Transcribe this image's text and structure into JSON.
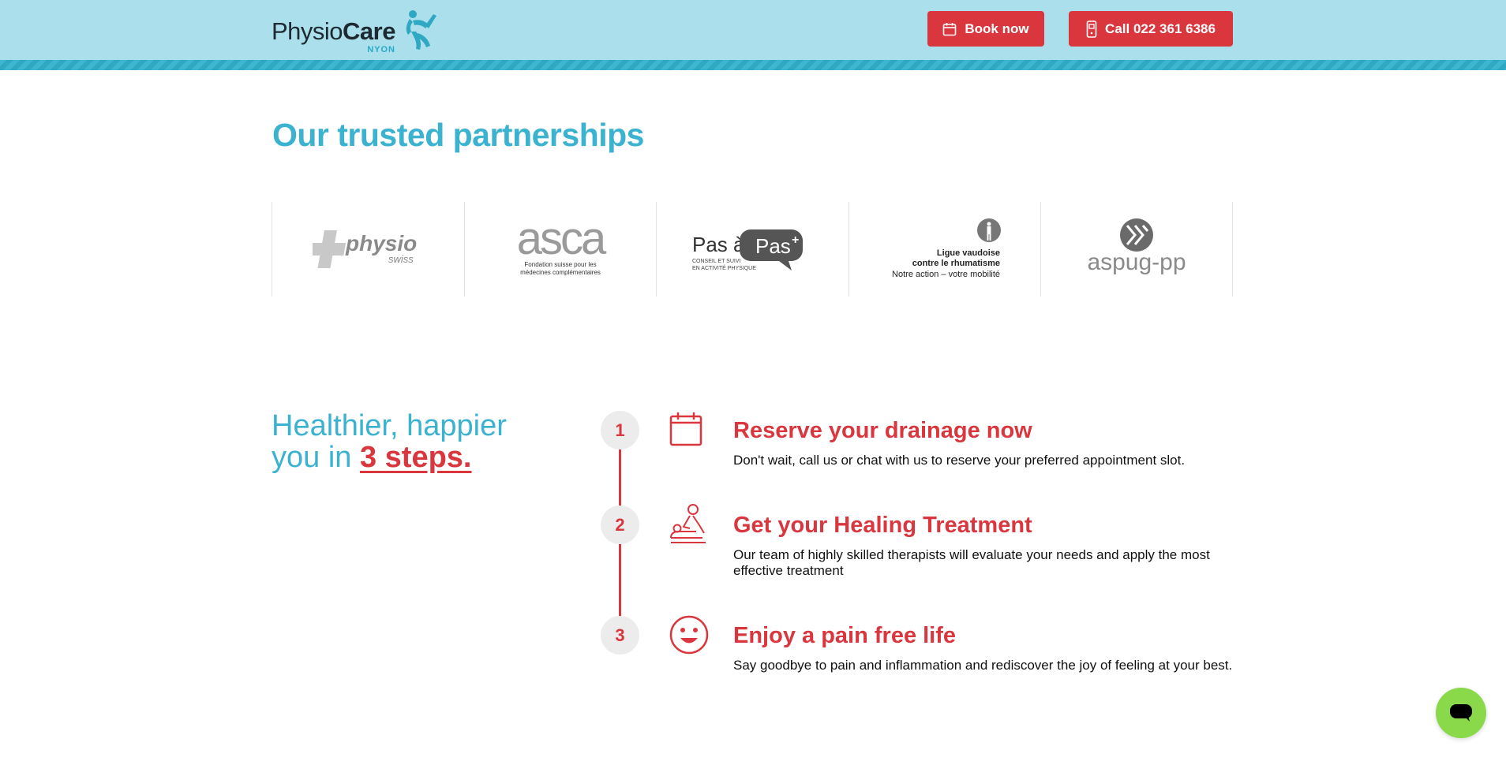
{
  "header": {
    "logo_light": "Physio",
    "logo_bold": "Care",
    "logo_sub": "NYON",
    "book_label": "Book now",
    "call_label": "Call 022 361 6386"
  },
  "partners": {
    "title": "Our trusted partnerships",
    "logos": [
      {
        "name": "physio",
        "sub": "swiss"
      },
      {
        "name": "asca",
        "sub1": "Fondation suisse pour les",
        "sub2": "médecines complémentaires"
      },
      {
        "name": "Pas à",
        "badge": "Pas",
        "plus": "+",
        "sub1": "CONSEIL ET SUIVI",
        "sub2": "EN ACTIVITÉ PHYSIQUE"
      },
      {
        "line1": "Ligue vaudoise",
        "line2": "contre le rhumatisme",
        "line3": "Notre action – votre mobilité"
      },
      {
        "name": "aspug-pp"
      }
    ]
  },
  "steps": {
    "title_line1": "Healthier, happier",
    "title_pre": "you in ",
    "title_em": "3 steps.",
    "items": [
      {
        "num": "1",
        "icon": "calendar-icon",
        "title": "Reserve your drainage now",
        "desc": "Don't wait, call us or chat with us to reserve your preferred appointment slot."
      },
      {
        "num": "2",
        "icon": "massage-icon",
        "title": "Get your Healing Treatment",
        "desc": "Our team of highly skilled therapists will evaluate your needs and apply the most effective treatment"
      },
      {
        "num": "3",
        "icon": "smiley-icon",
        "title": "Enjoy a pain free life",
        "desc": "Say goodbye to pain and inflammation and rediscover the joy of feeling at your best."
      }
    ]
  },
  "colors": {
    "header_bg": "#abdfeb",
    "accent_blue": "#3bb2d0",
    "accent_red": "#d9363e",
    "chat_green": "#8ad94a"
  }
}
